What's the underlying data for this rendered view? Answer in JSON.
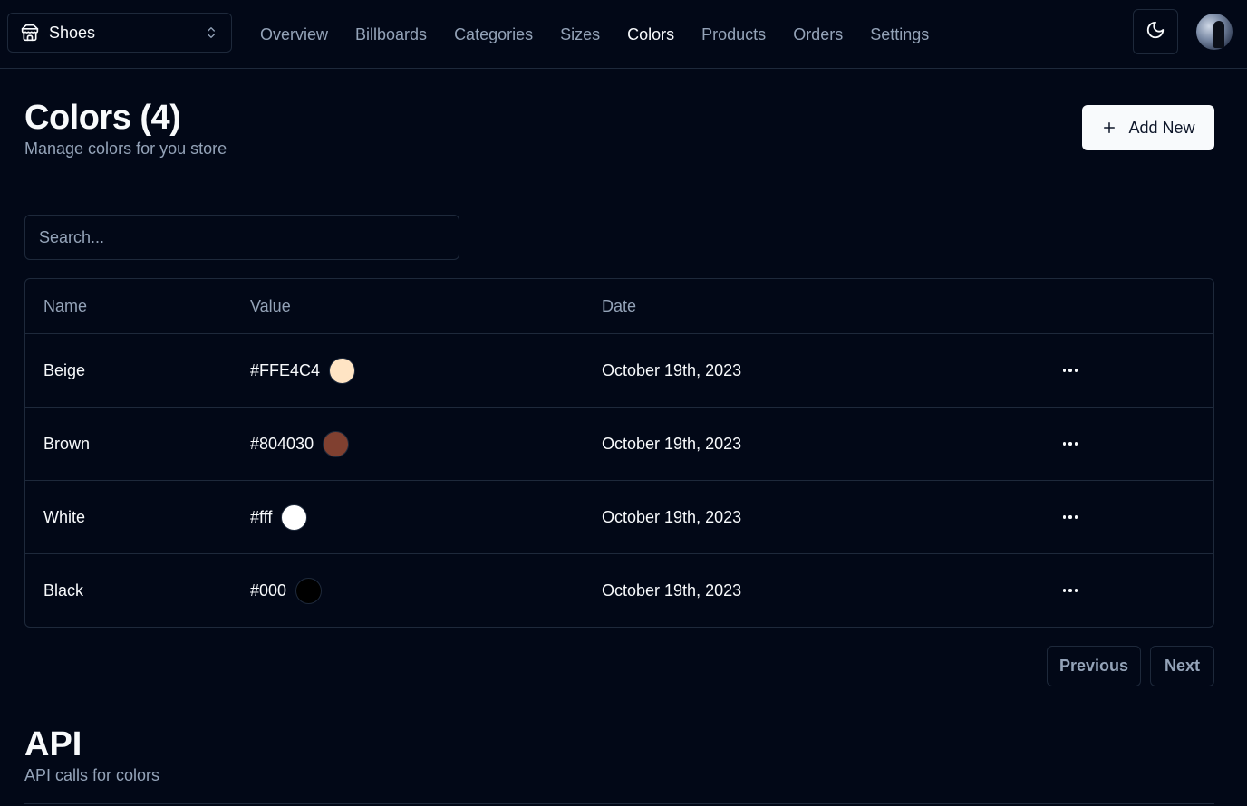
{
  "store": {
    "name": "Shoes",
    "icon": "store-icon"
  },
  "nav": {
    "links": [
      {
        "label": "Overview"
      },
      {
        "label": "Billboards"
      },
      {
        "label": "Categories"
      },
      {
        "label": "Sizes"
      },
      {
        "label": "Colors",
        "active": true
      },
      {
        "label": "Products"
      },
      {
        "label": "Orders"
      },
      {
        "label": "Settings"
      }
    ]
  },
  "header": {
    "title": "Colors (4)",
    "description": "Manage colors for you store",
    "add_label": "Add New"
  },
  "search": {
    "placeholder": "Search..."
  },
  "table": {
    "columns": [
      "Name",
      "Value",
      "Date"
    ],
    "rows": [
      {
        "name": "Beige",
        "value": "#FFE4C4",
        "swatch": "#FFE4C4",
        "date": "October 19th, 2023"
      },
      {
        "name": "Brown",
        "value": "#804030",
        "swatch": "#804030",
        "date": "October 19th, 2023"
      },
      {
        "name": "White",
        "value": "#fff",
        "swatch": "#ffffff",
        "date": "October 19th, 2023"
      },
      {
        "name": "Black",
        "value": "#000",
        "swatch": "#000000",
        "date": "October 19th, 2023"
      }
    ]
  },
  "pagination": {
    "previous": "Previous",
    "next": "Next"
  },
  "api": {
    "title": "API",
    "description": "API calls for colors"
  },
  "theme": {
    "background": "#020817",
    "border": "#1e293b",
    "muted": "#94a3b8",
    "foreground": "#f8fafc"
  }
}
